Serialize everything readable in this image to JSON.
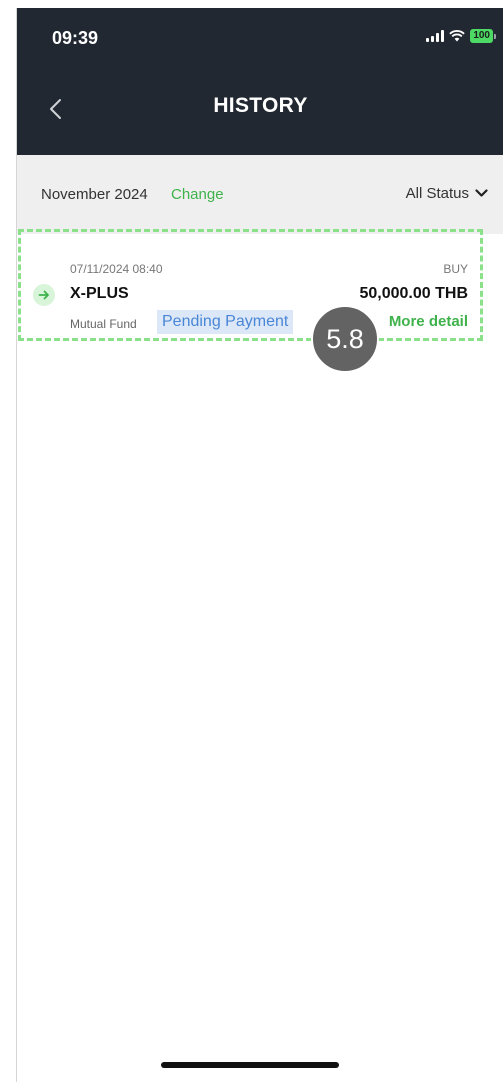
{
  "status_bar": {
    "time": "09:39",
    "battery": "100"
  },
  "header": {
    "title": "HISTORY",
    "back_icon": "chevron-left-icon"
  },
  "filter": {
    "month": "November 2024",
    "change_label": "Change",
    "status_label": "All Status",
    "status_icon": "chevron-down-icon"
  },
  "transactions": [
    {
      "datetime": "07/11/2024 08:40",
      "type": "BUY",
      "fund_name": "X-PLUS",
      "amount": "50,000.00 THB",
      "category": "Mutual Fund",
      "status": "Pending Payment",
      "detail_label": "More detail",
      "icon": "arrow-right-icon"
    }
  ],
  "annotation": {
    "step": "5.8"
  },
  "colors": {
    "header_bg": "#222831",
    "accent_green": "#3fb24b",
    "pending_text": "#4a86d6",
    "pending_bg": "#dce8f7",
    "highlight_border": "#8be08a"
  }
}
